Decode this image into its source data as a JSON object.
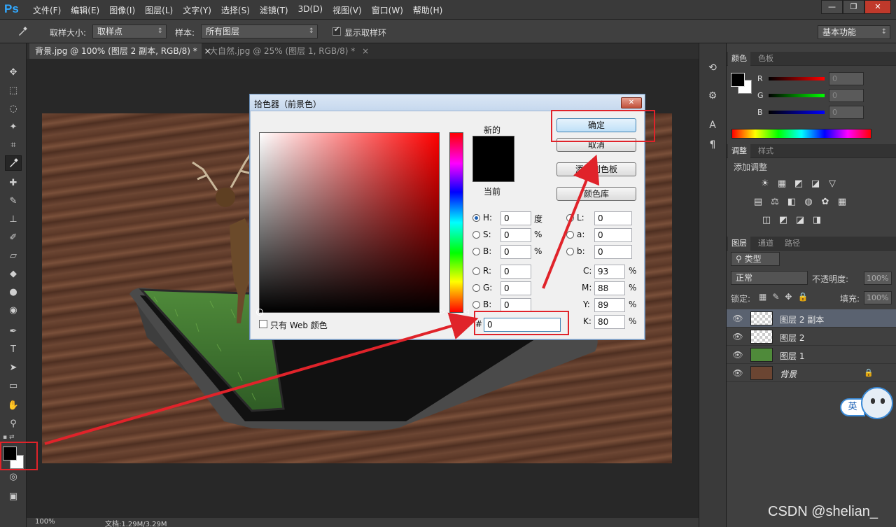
{
  "app": {
    "logo": "Ps"
  },
  "menu": [
    "文件(F)",
    "编辑(E)",
    "图像(I)",
    "图层(L)",
    "文字(Y)",
    "选择(S)",
    "滤镜(T)",
    "3D(D)",
    "视图(V)",
    "窗口(W)",
    "帮助(H)"
  ],
  "window_controls": {
    "minimize": "—",
    "restore": "❐",
    "close": "✕"
  },
  "options": {
    "sample_size_label": "取样大小:",
    "sample_size_value": "取样点",
    "sample_label": "样本:",
    "sample_value": "所有图层",
    "show_ring_label": "显示取样环",
    "workspace": "基本功能"
  },
  "tabs": [
    {
      "label": "背景.jpg @ 100% (图层 2 副本, RGB/8) *",
      "close": "×"
    },
    {
      "label": "大自然.jpg @ 25% (图层 1, RGB/8) *",
      "close": "×"
    }
  ],
  "status": {
    "zoom": "100%",
    "doc": "文档:1.29M/3.29M"
  },
  "picker": {
    "title": "拾色器（前景色）",
    "new_label": "新的",
    "current_label": "当前",
    "ok": "确定",
    "cancel": "取消",
    "add_swatch": "添加到色板",
    "color_libraries": "颜色库",
    "web_only": "只有 Web 颜色",
    "fields": {
      "H": {
        "label": "H:",
        "value": "0",
        "unit": "度"
      },
      "S": {
        "label": "S:",
        "value": "0",
        "unit": "%"
      },
      "Bv": {
        "label": "B:",
        "value": "0",
        "unit": "%"
      },
      "R": {
        "label": "R:",
        "value": "0"
      },
      "G": {
        "label": "G:",
        "value": "0"
      },
      "Bb": {
        "label": "B:",
        "value": "0"
      },
      "L": {
        "label": "L:",
        "value": "0"
      },
      "a": {
        "label": "a:",
        "value": "0"
      },
      "b": {
        "label": "b:",
        "value": "0"
      },
      "C": {
        "label": "C:",
        "value": "93",
        "unit": "%"
      },
      "M": {
        "label": "M:",
        "value": "88",
        "unit": "%"
      },
      "Y": {
        "label": "Y:",
        "value": "89",
        "unit": "%"
      },
      "K": {
        "label": "K:",
        "value": "80",
        "unit": "%"
      }
    },
    "hex_label": "#",
    "hex_value": "0",
    "current_color": "#000000",
    "new_color": "#000000"
  },
  "color_panel": {
    "tabs": [
      "颜色",
      "色板"
    ],
    "rows": [
      {
        "label": "R",
        "value": "0",
        "color": "#ff0000"
      },
      {
        "label": "G",
        "value": "0",
        "color": "#00ff00"
      },
      {
        "label": "B",
        "value": "0",
        "color": "#0000ff"
      }
    ]
  },
  "adjust_panel": {
    "tabs": [
      "调整",
      "样式"
    ],
    "title": "添加调整",
    "icons_row1": [
      "☀",
      "▦",
      "◩",
      "◪",
      "▽"
    ],
    "icons_row2": [
      "▤",
      "⚖",
      "◧",
      "◍",
      "✿",
      "▦"
    ],
    "icons_row3": [
      "◫",
      "◩",
      "◪",
      "◨"
    ]
  },
  "layers_panel": {
    "tabs": [
      "图层",
      "通道",
      "路径"
    ],
    "filter_label": "类型",
    "blend_mode": "正常",
    "opacity_label": "不透明度:",
    "opacity_value": "100%",
    "lock_label": "锁定:",
    "fill_label": "填充:",
    "fill_value": "100%",
    "layers": [
      {
        "name": "图层 2 副本",
        "selected": true
      },
      {
        "name": "图层 2",
        "selected": false
      },
      {
        "name": "图层 1",
        "selected": false
      },
      {
        "name": "背景",
        "selected": false
      }
    ]
  },
  "ime": {
    "label": "英"
  },
  "watermark": "CSDN @shelian_"
}
